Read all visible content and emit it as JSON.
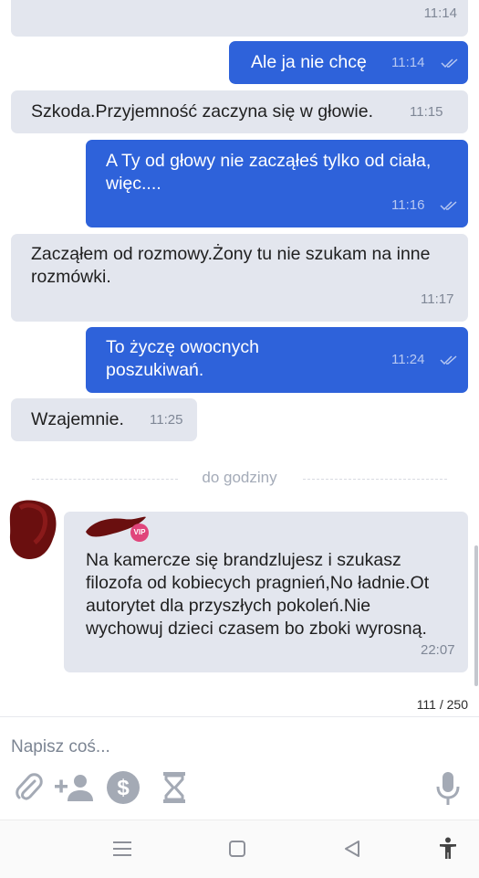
{
  "messages": [
    {
      "id": "m0",
      "dir": "in",
      "text": "",
      "time": "11:14"
    },
    {
      "id": "m1",
      "dir": "out",
      "text": "Ale ja nie chcę",
      "time": "11:14"
    },
    {
      "id": "m2",
      "dir": "in",
      "text": "Szkoda.Przyjemność zaczyna się w głowie.",
      "time": "11:15"
    },
    {
      "id": "m3",
      "dir": "out",
      "text": "A Ty od głowy nie zacząłeś tylko od ciała,\nwięc....",
      "time": "11:16"
    },
    {
      "id": "m4",
      "dir": "in",
      "text": "Zacząłem od rozmowy.Żony tu nie szukam na inne\nrozmówki.",
      "time": "11:17"
    },
    {
      "id": "m5",
      "dir": "out",
      "text": "To życzę owocnych\nposzukiwań.",
      "time": "11:24"
    },
    {
      "id": "m6",
      "dir": "in",
      "text": "Wzajemnie.",
      "time": "11:25"
    },
    {
      "id": "m7",
      "dir": "in",
      "text": "Na kamercze się brandzlujesz i szukasz\nfilozofa od kobiecych pragnień,No ładnie.Ot\nautorytet dla przyszłych pokoleń.Nie\nwychowuj dzieci czasem bo zboki wyrosną.",
      "time": "22:07"
    }
  ],
  "separator": {
    "label": "do godziny"
  },
  "sender": {
    "badge": "VIP"
  },
  "composer": {
    "placeholder": "Napisz coś...",
    "counter": "111 / 250"
  },
  "icons": {
    "attach": "paperclip-icon",
    "add_user": "add-user-icon",
    "money": "dollar-icon",
    "timer": "hourglass-icon",
    "mic": "microphone-icon",
    "nav_menu": "menu-icon",
    "nav_home": "home-icon",
    "nav_back": "back-icon",
    "nav_access": "accessibility-icon"
  },
  "colors": {
    "outgoing": "#2e62da",
    "incoming": "#e3e6ee",
    "badge": "#e0457b"
  }
}
